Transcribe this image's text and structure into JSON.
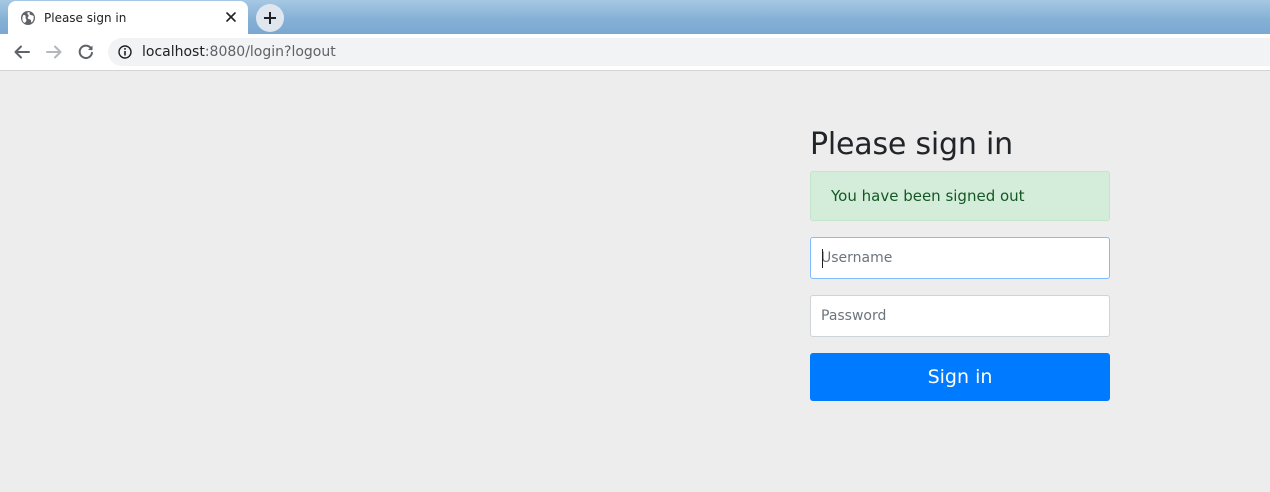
{
  "browser": {
    "tab": {
      "title": "Please sign in",
      "icon": "globe-icon"
    },
    "new_tab_icon": "plus-icon",
    "nav": {
      "back_icon": "arrow-left-icon",
      "forward_icon": "arrow-right-icon",
      "reload_icon": "reload-icon"
    },
    "address": {
      "icon": "info-icon",
      "host": "localhost",
      "rest": ":8080/login?logout"
    }
  },
  "page": {
    "heading": "Please sign in",
    "alert": {
      "text": "You have been signed out",
      "type": "success"
    },
    "username": {
      "value": "",
      "placeholder": "Username",
      "focused": true
    },
    "password": {
      "value": "",
      "placeholder": "Password"
    },
    "submit_label": "Sign in"
  },
  "colors": {
    "page_background": "#ededed",
    "primary": "#007bff",
    "alert_background": "#d4edda",
    "alert_text": "#155724"
  }
}
